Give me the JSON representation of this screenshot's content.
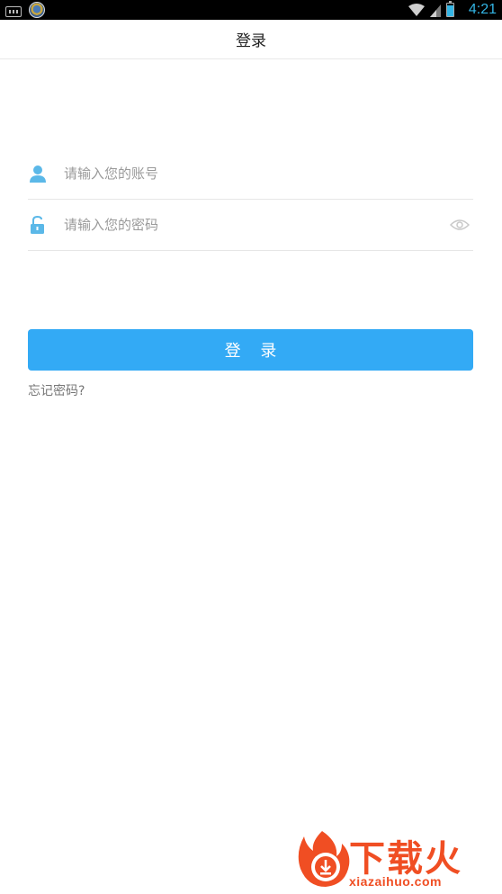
{
  "status_bar": {
    "time": "4:21",
    "icons": [
      "keyboard-icon",
      "app-badge-icon",
      "wifi-icon",
      "signal-icon",
      "battery-icon"
    ]
  },
  "header": {
    "title": "登录"
  },
  "form": {
    "account": {
      "placeholder": "请输入您的账号",
      "value": "",
      "icon": "user-icon"
    },
    "password": {
      "placeholder": "请输入您的密码",
      "value": "",
      "icon": "unlock-icon",
      "toggle_icon": "eye-icon"
    },
    "login_label": "登 录",
    "forgot_label": "忘记密码?"
  },
  "watermark": {
    "brand": "下载火",
    "url": "xiazaihuo.com"
  },
  "colors": {
    "accent": "#33aaf5",
    "icon_blue": "#5bb8e8",
    "watermark": "#f04e23",
    "clock": "#33b5e5"
  }
}
